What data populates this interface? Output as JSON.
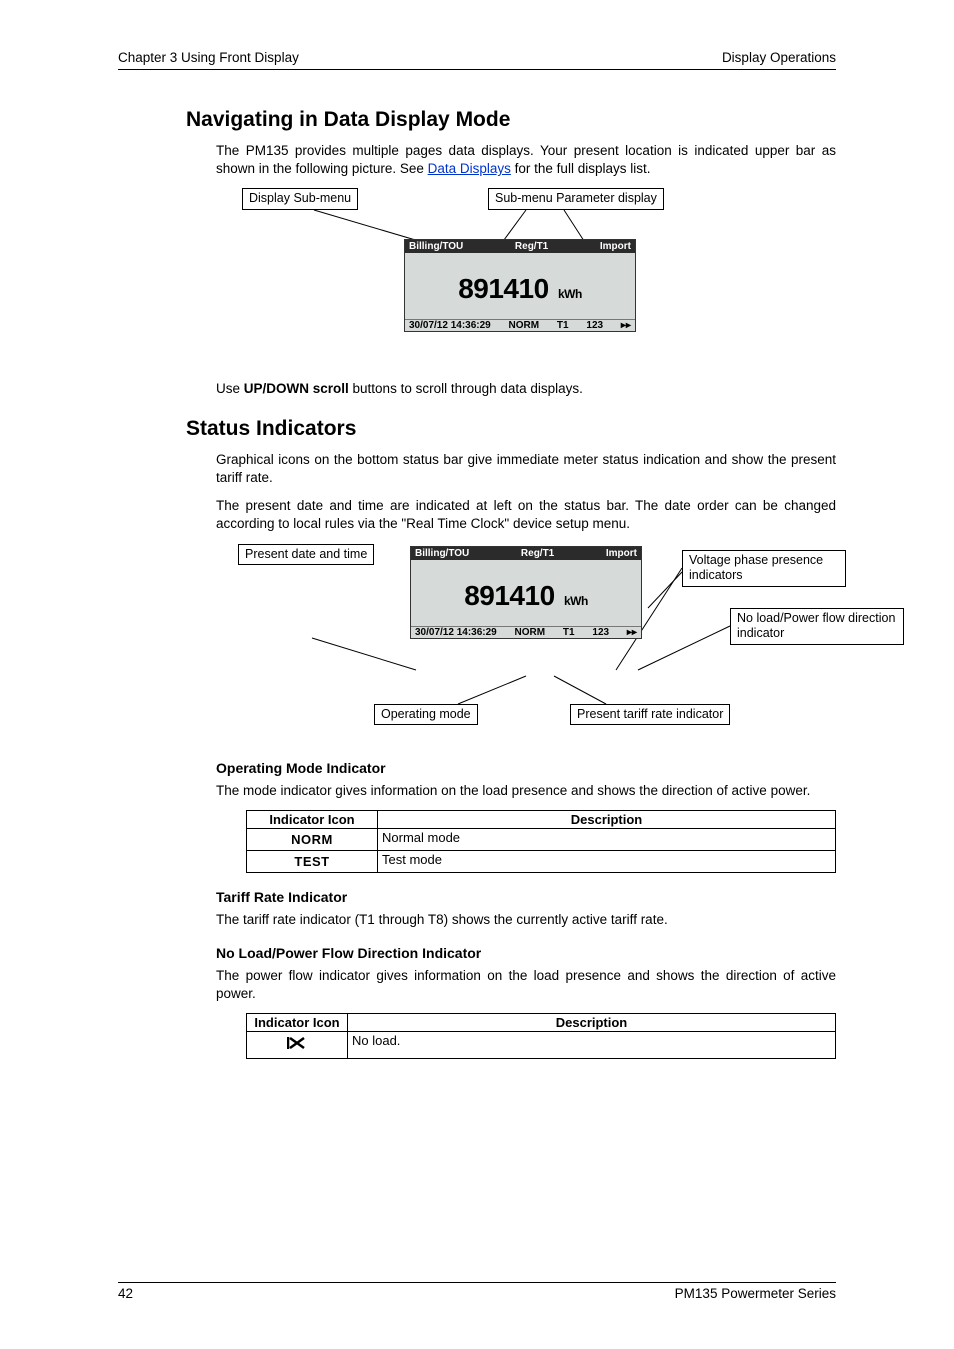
{
  "header": {
    "left": "Chapter 3   Using Front Display",
    "right": "Display Operations"
  },
  "section1": {
    "title": "Navigating in Data Display Mode",
    "p1_a": "The PM135 provides multiple pages data displays. Your present location is indicated upper bar as shown in the following picture. See ",
    "p1_link": "Data Displays",
    "p1_b": " for the full displays list.",
    "diagram": {
      "callout_submenu": "Display Sub-menu",
      "callout_param": "Sub-menu Parameter display",
      "lcd": {
        "top_left": "Billing/TOU",
        "top_mid": "Reg/T1",
        "top_right": "Import",
        "value": "891410",
        "unit": "kWh",
        "status_dt": "30/07/12 14:36:29",
        "status_mode": "NORM",
        "status_tariff": "T1",
        "status_phase": "123",
        "status_arrow": "▸▸"
      }
    },
    "p2_a": "Use ",
    "p2_b": "UP/DOWN scroll",
    "p2_c": " buttons to scroll through data displays."
  },
  "section2": {
    "title": "Status Indicators",
    "p1": "Graphical icons on the bottom status bar give immediate meter status indication and show the present tariff rate.",
    "p2": "The present date and time are indicated at left on the status bar. The date order can be changed according to local rules via the \"Real Time Clock\" device setup menu.",
    "diagram": {
      "callout_datetime": "Present date and time",
      "callout_voltage": "Voltage phase presence indicators",
      "callout_noload": "No load/Power flow direction indicator",
      "callout_opmode": "Operating mode",
      "callout_tariff": "Present tariff rate indicator",
      "lcd": {
        "top_left": "Billing/TOU",
        "top_mid": "Reg/T1",
        "top_right": "Import",
        "value": "891410",
        "unit": "kWh",
        "status_dt": "30/07/12 14:36:29",
        "status_mode": "NORM",
        "status_tariff": "T1",
        "status_phase": "123",
        "status_arrow": "▸▸"
      }
    },
    "opmode": {
      "heading": "Operating Mode Indicator",
      "desc": "The mode indicator gives information on the load presence and shows the direction of active power.",
      "table": {
        "h1": "Indicator Icon",
        "h2": "Description",
        "rows": [
          {
            "icon": "NORM",
            "desc": "Normal mode"
          },
          {
            "icon": "TEST",
            "desc": "Test mode"
          }
        ]
      }
    },
    "tariff": {
      "heading": "Tariff Rate Indicator",
      "desc": "The tariff rate indicator (T1 through T8) shows the currently active tariff rate."
    },
    "pflow": {
      "heading": "No Load/Power Flow Direction Indicator",
      "desc": "The power flow indicator gives information on the load presence and shows the direction of active power.",
      "table": {
        "h1": "Indicator Icon",
        "h2": "Description",
        "rows": [
          {
            "icon": "noload",
            "desc": "No load."
          }
        ]
      }
    }
  },
  "footer": {
    "page": "42",
    "series": "PM135 Powermeter Series"
  }
}
